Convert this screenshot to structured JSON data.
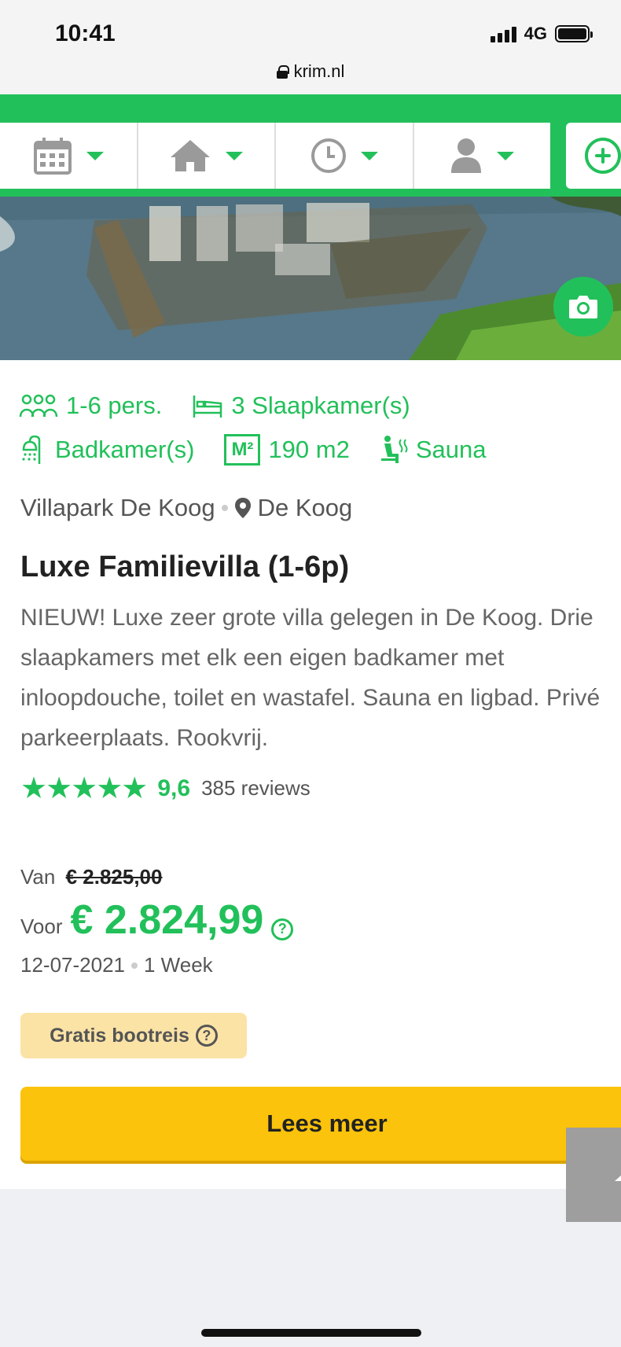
{
  "status_bar": {
    "time": "10:41",
    "network": "4G",
    "url": "krim.nl"
  },
  "filters": {
    "items": [
      {
        "icon": "calendar-icon"
      },
      {
        "icon": "house-icon"
      },
      {
        "icon": "clock-icon"
      },
      {
        "icon": "person-icon"
      }
    ],
    "add_icon": "plus-circle-icon",
    "accent_color": "#22c05a"
  },
  "listing": {
    "features": {
      "persons": "1-6 pers.",
      "bedrooms": "3 Slaapkamer(s)",
      "bathrooms": "Badkamer(s)",
      "m2_icon_label": "M²",
      "area": "190 m2",
      "sauna": "Sauna"
    },
    "park": "Villapark De Koog",
    "location": "De Koog",
    "title": "Luxe Familievilla (1-6p)",
    "description": "NIEUW! Luxe zeer grote villa gelegen in De Koog. Drie slaapkamers met elk een eigen badkamer met inloopdouche, toilet en wastafel. Sauna en ligbad. Privé parkeerplaats. Rookvrij.",
    "stars": "★★★★★",
    "score": "9,6",
    "reviews": "385 reviews",
    "van_label": "Van",
    "old_price": "€ 2.825,00",
    "voor_label": "Voor",
    "price": "€ 2.824,99",
    "help_glyph": "?",
    "date": "12-07-2021",
    "duration": "1 Week",
    "badge": "Gratis bootreis",
    "cta": "Lees meer"
  }
}
